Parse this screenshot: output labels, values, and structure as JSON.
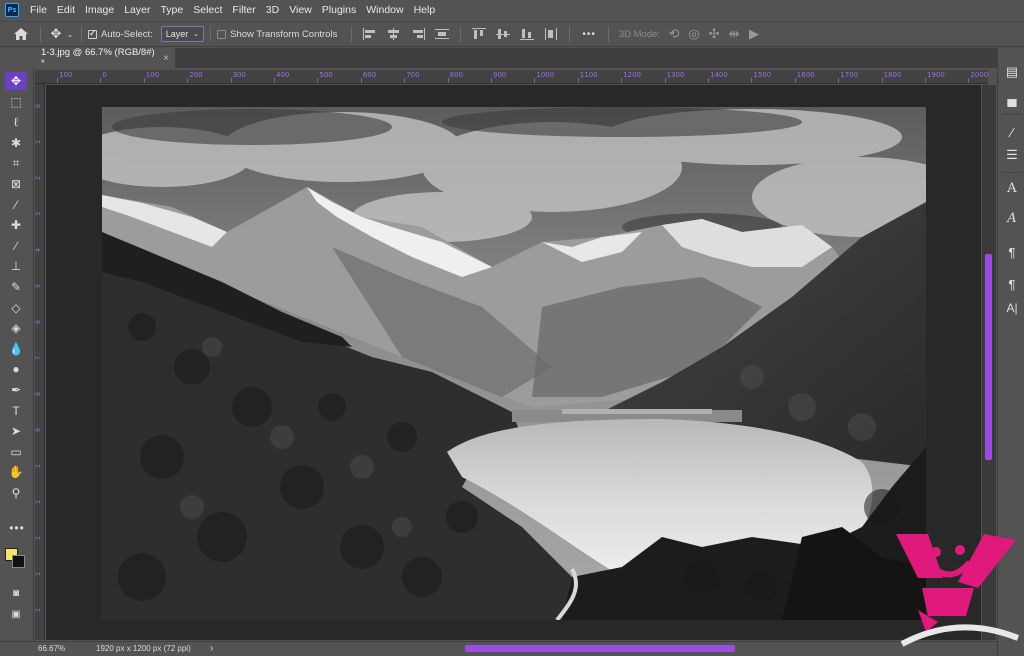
{
  "app": {
    "logo_text": "Ps"
  },
  "menu": [
    "File",
    "Edit",
    "Image",
    "Layer",
    "Type",
    "Select",
    "Filter",
    "3D",
    "View",
    "Plugins",
    "Window",
    "Help"
  ],
  "options": {
    "auto_select_label": "Auto-Select:",
    "auto_select_checked": true,
    "layer_select_value": "Layer",
    "transform_controls_label": "Show Transform Controls",
    "transform_controls_checked": false,
    "more_label": "•••",
    "mode_3d_label": "3D Mode:"
  },
  "document_tab": {
    "title": "1-3.jpg @ 66.7% (RGB/8#) *",
    "close": "×"
  },
  "ruler": {
    "h_labels": [
      "100",
      "0",
      "100",
      "200",
      "300",
      "400",
      "500",
      "600",
      "700",
      "800",
      "900",
      "1000",
      "1100",
      "1200",
      "1300",
      "1400",
      "1500",
      "1600",
      "1700",
      "1800",
      "1900",
      "2000"
    ],
    "v_labels": [
      "0",
      "1",
      "2",
      "3",
      "4",
      "5",
      "6",
      "7",
      "8",
      "9",
      "1",
      "1",
      "1",
      "1",
      "1"
    ]
  },
  "status": {
    "zoom": "66.67%",
    "doc_info": "1920 px x 1200 px (72 ppi)",
    "arrow": "›"
  },
  "colors": {
    "accent": "#6d41c4",
    "scrollbar": "#9b4de0",
    "foreground_swatch": "#f2e46b",
    "background_swatch": "#111111",
    "watermark": "#e0197d"
  },
  "tools": [
    "move-tool",
    "marquee-tool",
    "lasso-tool",
    "magic-wand-tool",
    "crop-tool",
    "frame-tool",
    "eyedropper-tool",
    "healing-tool",
    "brush-tool",
    "stamp-tool",
    "history-brush-tool",
    "eraser-tool",
    "paint-bucket-tool",
    "blur-tool",
    "dodge-tool",
    "pen-tool",
    "type-tool",
    "path-select-tool",
    "rectangle-tool",
    "hand-tool",
    "zoom-tool"
  ],
  "tool_glyphs": [
    "✥",
    "⬚",
    "ℓ",
    "✱",
    "⌗",
    "⊠",
    "⁄",
    "✚",
    "∕",
    "⊥",
    "✎",
    "◇",
    "◈",
    "💧",
    "●",
    "✒",
    "T",
    "➤",
    "▭",
    "✋",
    "⚲"
  ],
  "active_tool": "move-tool"
}
